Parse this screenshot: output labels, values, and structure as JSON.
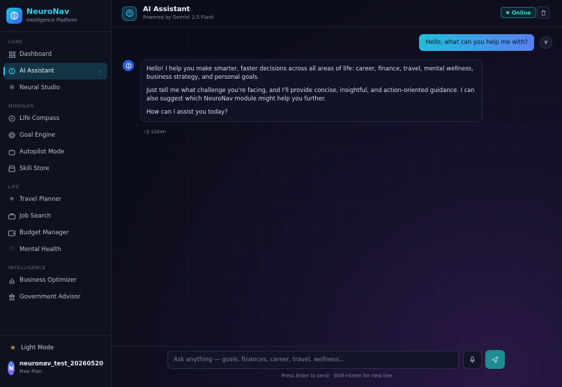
{
  "brand": {
    "title": "NeuroNav",
    "subtitle": "Intelligence Platform"
  },
  "sidebar": {
    "sections": [
      {
        "label": "CORE",
        "items": [
          {
            "label": "Dashboard",
            "icon": "grid-icon"
          },
          {
            "label": "AI Assistant",
            "icon": "brain-icon",
            "active": true
          },
          {
            "label": "Neural Studio",
            "icon": "sparkles-icon"
          }
        ]
      },
      {
        "label": "MODULES",
        "items": [
          {
            "label": "Life Compass",
            "icon": "compass-icon"
          },
          {
            "label": "Goal Engine",
            "icon": "target-icon"
          },
          {
            "label": "Autopilot Mode",
            "icon": "bot-icon"
          },
          {
            "label": "Skill Store",
            "icon": "store-icon"
          }
        ]
      },
      {
        "label": "LIFE",
        "items": [
          {
            "label": "Travel Planner",
            "icon": "plane-icon"
          },
          {
            "label": "Job Search",
            "icon": "briefcase-icon"
          },
          {
            "label": "Budget Manager",
            "icon": "wallet-icon"
          },
          {
            "label": "Mental Health",
            "icon": "heart-icon"
          }
        ]
      },
      {
        "label": "INTELLIGENCE",
        "items": [
          {
            "label": "Business Optimizer",
            "icon": "bar-chart-icon"
          },
          {
            "label": "Government Advisor",
            "icon": "building-icon"
          }
        ]
      }
    ],
    "light_mode_label": "Light Mode",
    "user": {
      "initial": "N",
      "name": "neuronav_test_20260520",
      "plan": "Free Plan"
    }
  },
  "header": {
    "title": "AI Assistant",
    "subtitle": "Powered by Gemini 2.5 Flash",
    "status": "Online"
  },
  "chat": {
    "user_message": "Hello, what can you help me with?",
    "user_badge": "Y",
    "ai_paragraphs": [
      "Hello! I help you make smarter, faster decisions across all areas of life: career, finance, travel, mental wellness, business strategy, and personal goals.",
      "Just tell me what challenge you're facing, and I'll provide concise, insightful, and action-oriented guidance. I can also suggest which NeuroNav module might help you further.",
      "How can I assist you today?"
    ],
    "listen_label": "Listen"
  },
  "composer": {
    "placeholder": "Ask anything — goals, finances, career, travel, wellness...",
    "value": "",
    "hint": "Press Enter to send · Shift+Enter for new line"
  },
  "colors": {
    "accent": "#2fd0ee",
    "send_button": "#1c8e92",
    "online": "#38d6c6",
    "background": "#0c0d1a"
  }
}
